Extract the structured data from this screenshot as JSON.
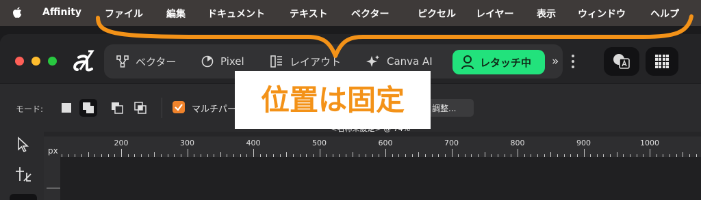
{
  "menubar": {
    "app": "Affinity",
    "items": [
      "ファイル",
      "編集",
      "ドキュメント",
      "テキスト",
      "ベクター",
      "ピクセル",
      "レイヤー",
      "表示",
      "ウィンドウ",
      "ヘルプ"
    ]
  },
  "toolbar": {
    "personas": [
      "ベクター",
      "Pixel",
      "レイアウト",
      "Canva AI"
    ],
    "locked_label": "レタッチ中",
    "more": "»"
  },
  "context": {
    "mode_label": "モード:",
    "multi_label": "マルチパー",
    "adjust_label": "調整..."
  },
  "document": {
    "title": "<名称未設定> @ 74%*",
    "ruler_unit": "px",
    "ruler_labels": [
      "200",
      "300",
      "400",
      "500",
      "600",
      "700",
      "800",
      "900",
      "1000"
    ]
  },
  "annotation": {
    "text": "位置は固定",
    "color": "#f39218"
  },
  "colors": {
    "accent_green": "#22e27c",
    "checkbox_orange": "#f0832b"
  }
}
